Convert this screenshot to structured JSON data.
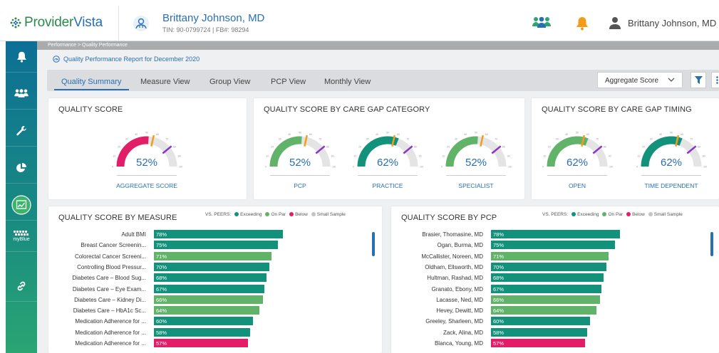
{
  "brand": {
    "part1": "Provider",
    "part2": "Vista"
  },
  "provider": {
    "name": "Brittany Johnson, MD",
    "sub": "TIN: 90-0799724  |  FB#: 98294"
  },
  "user": {
    "name": "Brittany Johnson, MD"
  },
  "sidebar": {
    "items": [
      {
        "icon": "bell-icon"
      },
      {
        "icon": "group-icon"
      },
      {
        "icon": "wrench-icon"
      },
      {
        "icon": "pie-chart-icon"
      },
      {
        "icon": "trend-chart-icon"
      },
      {
        "icon": "myblue-icon",
        "label": "myBlue"
      },
      {
        "icon": "link-icon"
      }
    ]
  },
  "breadcrumb": "Performance  >  Quality Performance",
  "report_title": "Quality Performance Report for December 2020",
  "tabs": [
    {
      "label": "Quality Summary",
      "active": true
    },
    {
      "label": "Measure View"
    },
    {
      "label": "Group View"
    },
    {
      "label": "PCP View"
    },
    {
      "label": "Monthly View"
    }
  ],
  "aggregate_select": "Aggregate Score",
  "colors": {
    "exceeding": "#12927a",
    "on_par": "#62b36a",
    "below": "#e11e67",
    "small_sample": "#c4c4c4",
    "accent": "#2a6fb0",
    "orange": "#f39c1b",
    "purple": "#8b35c4"
  },
  "cards": {
    "quality_score": {
      "title": "QUALITY SCORE",
      "gauges": [
        {
          "label": "AGGREGATE SCORE",
          "value": 52,
          "color": "#e11e67"
        }
      ]
    },
    "care_gap_category": {
      "title": "QUALITY SCORE BY CARE GAP CATEGORY",
      "gauges": [
        {
          "label": "PCP",
          "value": 52,
          "color": "#62b36a"
        },
        {
          "label": "PRACTICE",
          "value": 62,
          "color": "#12927a"
        },
        {
          "label": "SPECIALIST",
          "value": 52,
          "color": "#62b36a"
        }
      ]
    },
    "care_gap_timing": {
      "title": "QUALITY SCORE BY CARE GAP TIMING",
      "gauges": [
        {
          "label": "OPEN",
          "value": 62,
          "color": "#62b36a"
        },
        {
          "label": "TIME DEPENDENT",
          "value": 62,
          "color": "#12927a"
        }
      ]
    }
  },
  "gauge_ticks": [
    "0",
    "10",
    "20",
    "30",
    "40",
    "50",
    "60",
    "70",
    "80",
    "90",
    "100"
  ],
  "legend": {
    "prefix": "VS. PEERS:",
    "items": [
      "Exceeding",
      "On Par",
      "Below",
      "Small Sample"
    ]
  },
  "by_measure": {
    "title": "QUALITY SCORE BY MEASURE",
    "rows": [
      {
        "label": "Adult BMI",
        "value": 78,
        "status": "exceeding"
      },
      {
        "label": "Breast Cancer Screenin...",
        "value": 75,
        "status": "exceeding"
      },
      {
        "label": "Colorectal Cancer Screeni...",
        "value": 71,
        "status": "on_par"
      },
      {
        "label": "Controlling Blood Pressur...",
        "value": 70,
        "status": "exceeding"
      },
      {
        "label": "Diabetes Care – Blood Sug...",
        "value": 68,
        "status": "exceeding"
      },
      {
        "label": "Diabetes Care – Eye Exam...",
        "value": 67,
        "status": "exceeding"
      },
      {
        "label": "Diabetes Care – Kidney Di...",
        "value": 66,
        "status": "on_par"
      },
      {
        "label": "Diabetes Care – HbA1c Sc...",
        "value": 64,
        "status": "on_par"
      },
      {
        "label": "Medication Adherence for ...",
        "value": 60,
        "status": "exceeding"
      },
      {
        "label": "Medication Adherence for ...",
        "value": 58,
        "status": "exceeding"
      },
      {
        "label": "Medication Adherence for ...",
        "value": 57,
        "status": "below"
      }
    ]
  },
  "by_pcp": {
    "title": "QUALITY SCORE BY PCP",
    "rows": [
      {
        "label": "Brasier, Thomasine, MD",
        "value": 78,
        "status": "exceeding"
      },
      {
        "label": "Ogan, Burma, MD",
        "value": 75,
        "status": "exceeding"
      },
      {
        "label": "McCallister, Noreen, MD",
        "value": 71,
        "status": "on_par"
      },
      {
        "label": "Oldham, Ellsworth, MD",
        "value": 70,
        "status": "exceeding"
      },
      {
        "label": "Hultman, Rashad, MD",
        "value": 68,
        "status": "exceeding"
      },
      {
        "label": "Granato, Ebony, MD",
        "value": 67,
        "status": "exceeding"
      },
      {
        "label": "Lacasse, Ned, MD",
        "value": 66,
        "status": "on_par"
      },
      {
        "label": "Hevey, Dewitt, MD",
        "value": 64,
        "status": "on_par"
      },
      {
        "label": "Greeley, Sharleen, MD",
        "value": 60,
        "status": "exceeding"
      },
      {
        "label": "Zack, Alina, MD",
        "value": 58,
        "status": "exceeding"
      },
      {
        "label": "Blanca, Young, MD",
        "value": 57,
        "status": "below"
      }
    ]
  }
}
